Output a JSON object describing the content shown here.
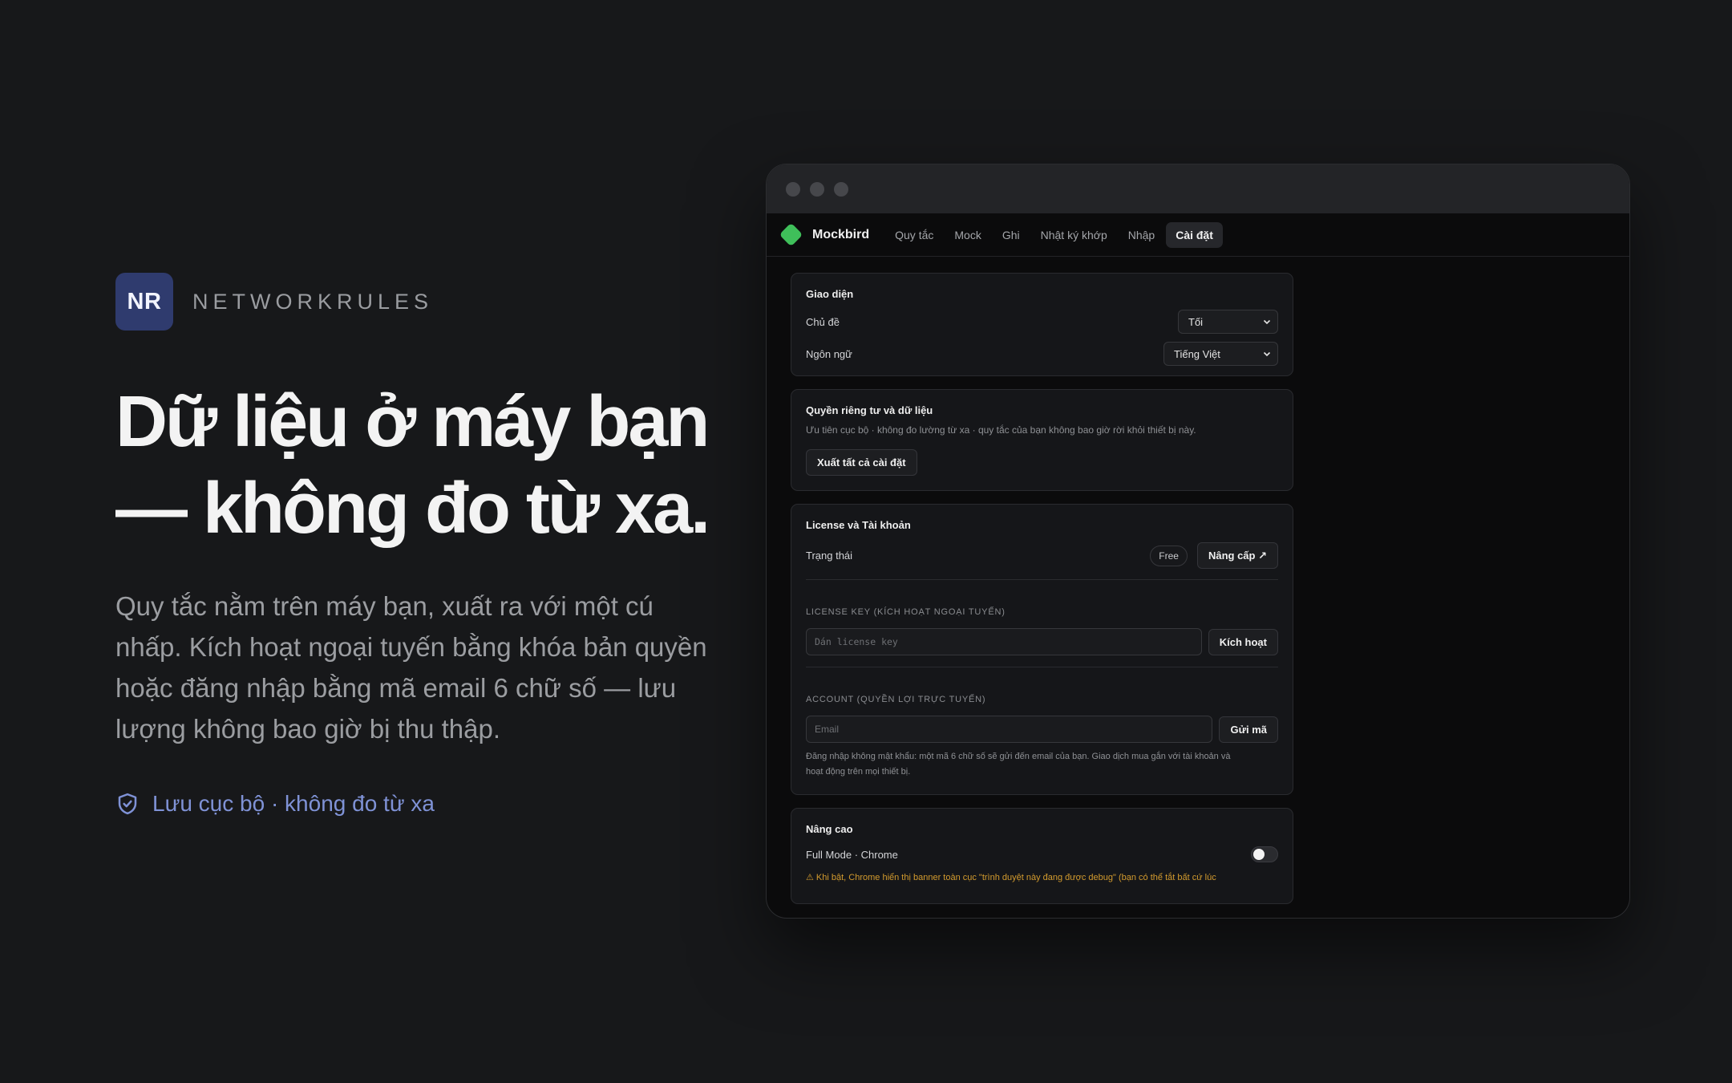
{
  "hero": {
    "badge": "NR",
    "brand": "NETWORKRULES",
    "headline_line1": "Dữ liệu ở máy bạn",
    "headline_line2": "— không đo từ xa.",
    "sub_line1": "Quy tắc nằm trên máy bạn, xuất ra với một cú",
    "sub_line2": "nhấp. Kích hoạt ngoại tuyến bằng khóa bản quyền",
    "sub_line3": "hoặc đăng nhập bằng mã email 6 chữ số — lưu",
    "sub_line4": "lượng không bao giờ bị thu thập.",
    "local_note": "Lưu cục bộ · không đo từ xa",
    "icon": "shield-check-icon",
    "accent_color": "#7f92d6"
  },
  "app": {
    "name": "Mockbird",
    "logo_color": "#3fbf5a",
    "nav": [
      {
        "label": "Quy tắc"
      },
      {
        "label": "Mock"
      },
      {
        "label": "Ghi"
      },
      {
        "label": "Nhật ký khớp"
      },
      {
        "label": "Nhập"
      },
      {
        "label": "Cài đặt",
        "active": true
      }
    ]
  },
  "appearance": {
    "title": "Giao diện",
    "theme_label": "Chủ đề",
    "theme_value": "Tối",
    "language_label": "Ngôn ngữ",
    "language_value": "Tiếng Việt"
  },
  "privacy": {
    "title": "Quyền riêng tư và dữ liệu",
    "desc": "Ưu tiên cục bộ · không đo lường từ xa · quy tắc của bạn không bao giờ rời khỏi thiết bị này.",
    "export_button": "Xuất tất cả cài đặt"
  },
  "license": {
    "title": "License và Tài khoản",
    "status_label": "Trạng thái",
    "status_value": "Free",
    "upgrade_button": "Nâng cấp ↗",
    "key_caption": "LICENSE KEY (KÍCH HOẠT NGOẠI TUYẾN)",
    "key_placeholder": "Dán license key",
    "activate_button": "Kích hoạt",
    "account_caption": "ACCOUNT (QUYỀN LỢI TRỰC TUYẾN)",
    "email_placeholder": "Email",
    "send_code_button": "Gửi mã",
    "note_line1": "Đăng nhập không mật khẩu: một mã 6 chữ số sẽ gửi đến email của bạn. Giao dịch mua gắn với tài khoản và",
    "note_line2": "hoạt động trên mọi thiết bị."
  },
  "advanced": {
    "title": "Nâng cao",
    "full_mode_label": "Full Mode · Chrome",
    "full_mode_enabled": false,
    "warning": "⚠ Khi bật, Chrome hiển thị banner toàn cục \"trình duyệt này đang được debug\" (bạn có thể tắt bất cứ lúc",
    "warning_color": "#d39b2e"
  }
}
